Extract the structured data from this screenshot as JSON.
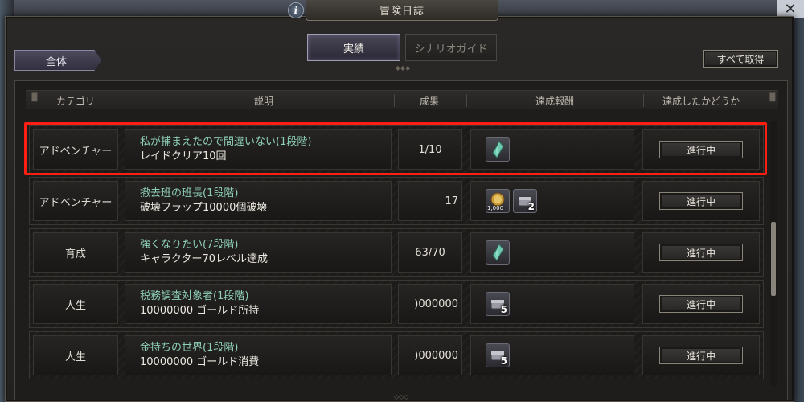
{
  "window": {
    "title": "冒険日誌"
  },
  "tabs": [
    {
      "label": "実績",
      "active": true
    },
    {
      "label": "シナリオガイド",
      "active": false
    }
  ],
  "filter": {
    "label": "全体"
  },
  "receive_all": {
    "label": "すべて取得"
  },
  "columns": {
    "category": "カテゴリ",
    "description": "説明",
    "progress": "成果",
    "reward": "達成報酬",
    "status": "達成したかどうか"
  },
  "rows": [
    {
      "category": "アドベンチャー",
      "title": "私が捕まえたので間違いない(1段階)",
      "desc": "レイドクリア10回",
      "progress": "1/10",
      "rewards": [
        {
          "icon": "crystal-icon",
          "count": ""
        }
      ],
      "status": "進行中",
      "highlighted": true
    },
    {
      "category": "アドベンチャー",
      "title": "撤去班の班長(1段階)",
      "desc": "破壊フラップ10000個破壊",
      "progress": "17",
      "rewards": [
        {
          "icon": "gold-coin-icon",
          "count": "",
          "sub": "1,000"
        },
        {
          "icon": "chest-icon",
          "count": "2"
        }
      ],
      "status": "進行中"
    },
    {
      "category": "育成",
      "title": "強くなりたい(7段階)",
      "desc": "キャラクター70レベル達成",
      "progress": "63/70",
      "rewards": [
        {
          "icon": "crystal-icon",
          "count": ""
        }
      ],
      "status": "進行中"
    },
    {
      "category": "人生",
      "title": "税務調査対象者(1段階)",
      "desc": "10000000 ゴールド所持",
      "progress": ")000000",
      "rewards": [
        {
          "icon": "chest-icon",
          "count": "5"
        }
      ],
      "status": "進行中"
    },
    {
      "category": "人生",
      "title": "金持ちの世界(1段階)",
      "desc": "10000000 ゴールド消費",
      "progress": ")000000",
      "rewards": [
        {
          "icon": "chest-icon",
          "count": "5"
        }
      ],
      "status": "進行中"
    }
  ]
}
